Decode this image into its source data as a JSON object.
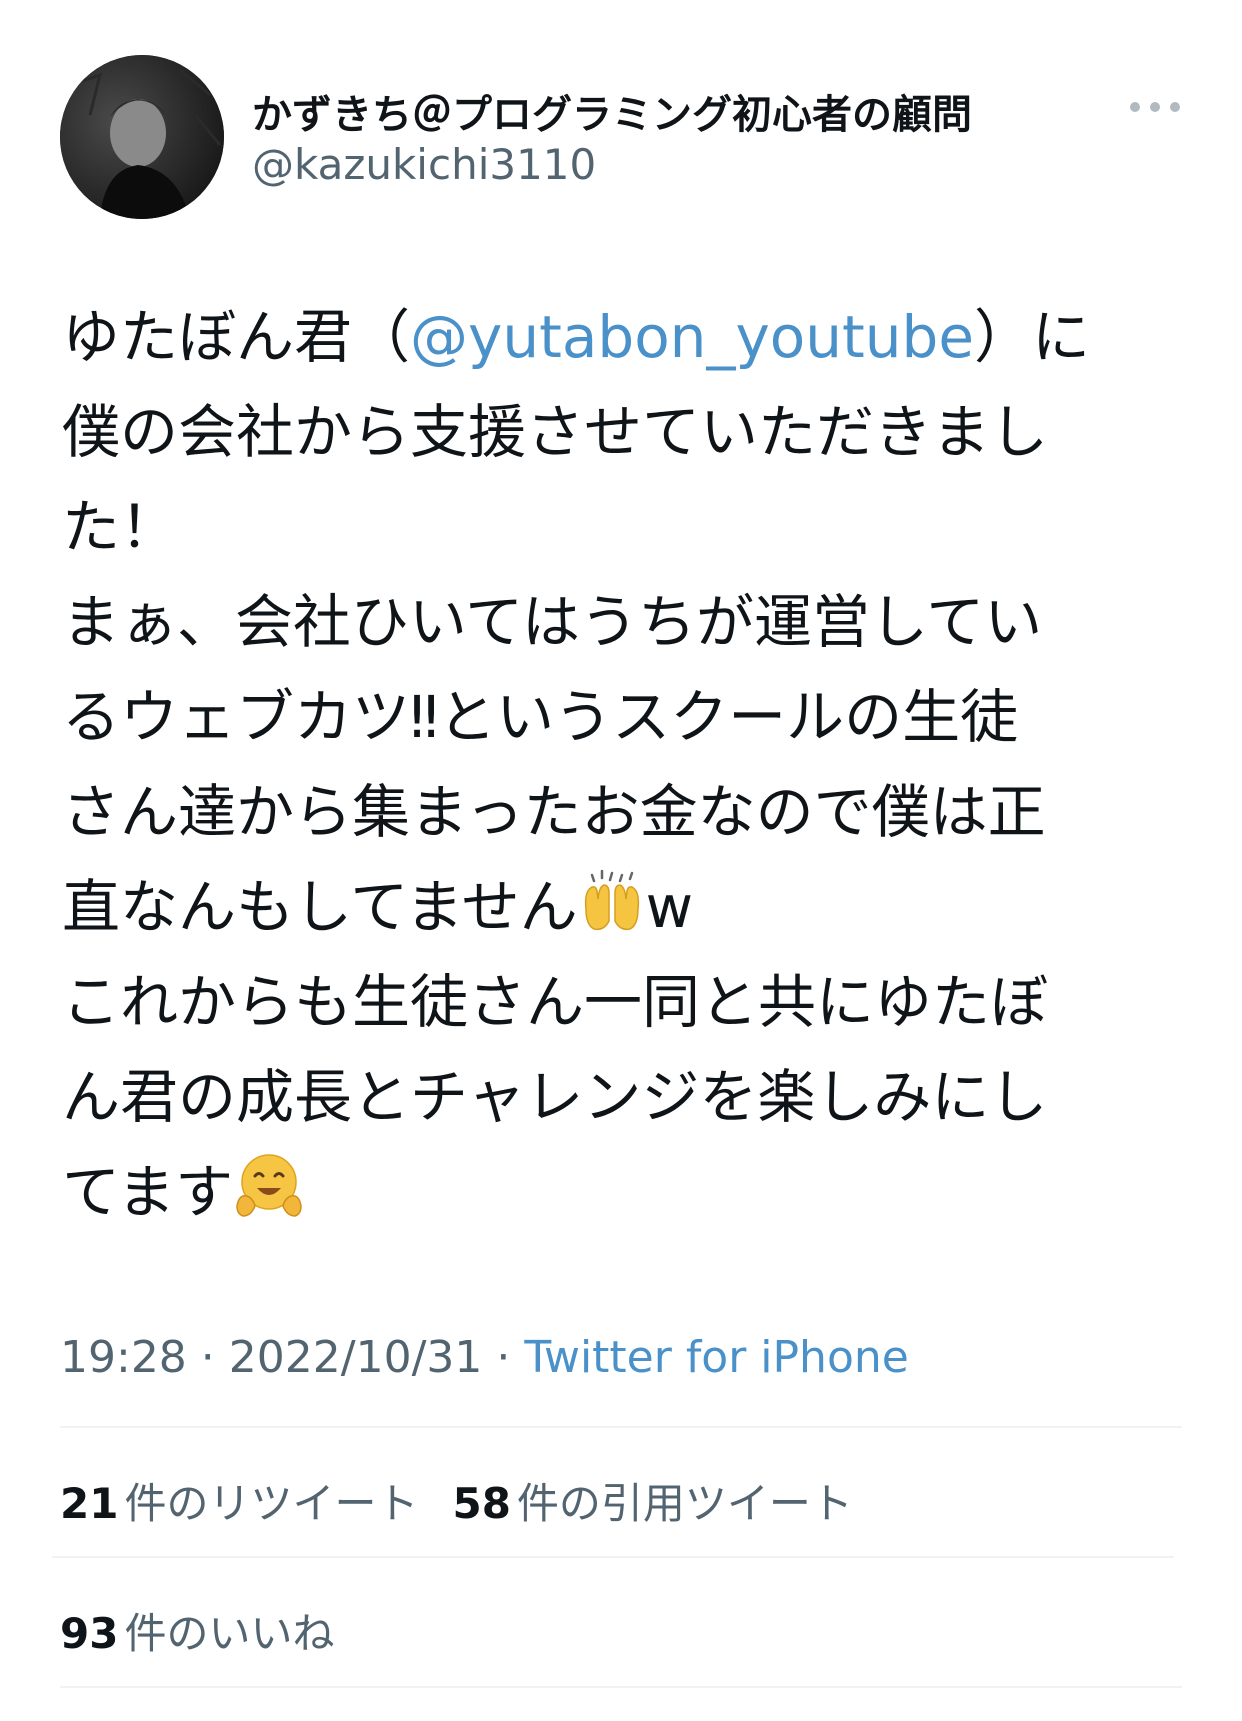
{
  "user": {
    "display_name": "かずきち＠プログラミング初心者の顧問",
    "handle": "@kazukichi3110"
  },
  "tweet": {
    "lines": [
      {
        "before": "ゆたぼん君（",
        "mention": "@yutabon_youtube",
        "after": "）に"
      },
      {
        "text": "僕の会社から支援させていただきまし"
      },
      {
        "text": "た！"
      },
      {
        "text": "まぁ、会社ひいてはうちが運営してい"
      },
      {
        "text": "るウェブカツ‼というスクールの生徒"
      },
      {
        "text": "さん達から集まったお金なので僕は正"
      },
      {
        "before": "直なんもしてません",
        "emoji": "raising-hands-emoji",
        "after": "w"
      },
      {
        "text": "これからも生徒さん一同と共にゆたぼ"
      },
      {
        "text": "ん君の成長とチャレンジを楽しみにし"
      },
      {
        "before": "てます",
        "emoji": "hugging-face-emoji",
        "after": ""
      }
    ]
  },
  "meta": {
    "time": "19:28",
    "separator": " · ",
    "date": "2022/10/31",
    "source": "Twitter for iPhone"
  },
  "stats": {
    "retweets": {
      "count": "21",
      "label": "件のリツイート"
    },
    "quotes": {
      "count": "58",
      "label": "件の引用ツイート"
    },
    "likes": {
      "count": "93",
      "label": "件のいいね"
    }
  },
  "colors": {
    "link": "#4a90c9",
    "secondary_text": "#536471",
    "divider": "#eff3f4"
  },
  "icons": {
    "more": "more-options-icon"
  }
}
